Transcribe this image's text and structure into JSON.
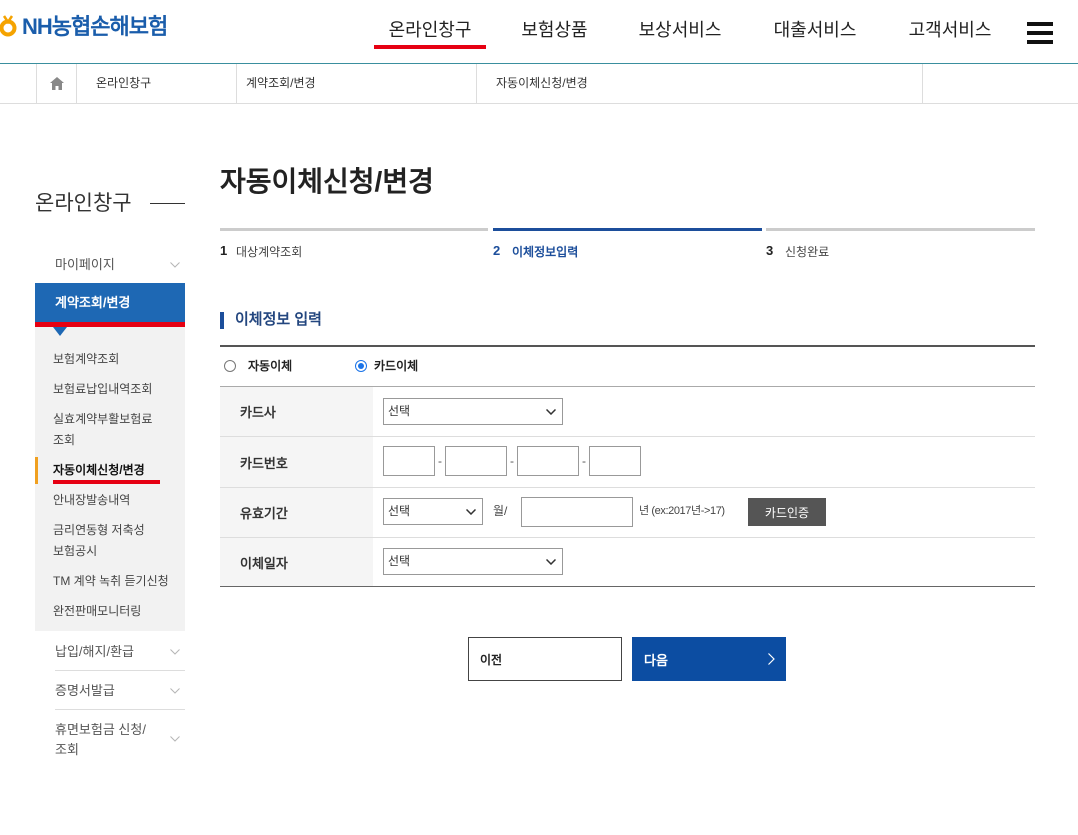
{
  "colors": {
    "brand_blue": "#1a5dab",
    "nav_underline_red": "#e60012",
    "header_line": "#3a8f9e",
    "menu_active_blue": "#1e68b4",
    "step_active_blue": "#1c4e9b",
    "next_button_blue": "#0c4da2",
    "logo_yellow": "#f5a300",
    "current_item_orange": "#f0a020",
    "radio_checked_blue": "#1a73e8",
    "section_title_navy": "#23467f"
  },
  "header": {
    "logo_icon": "nh-logo-icon",
    "logo_text": "NH농협손해보험",
    "nav": [
      {
        "label": "온라인창구",
        "active": true
      },
      {
        "label": "보험상품",
        "active": false
      },
      {
        "label": "보상서비스",
        "active": false
      },
      {
        "label": "대출서비스",
        "active": false
      },
      {
        "label": "고객서비스",
        "active": false
      }
    ],
    "menu_icon": "hamburger-menu-icon"
  },
  "breadcrumb": {
    "home_icon": "home-icon",
    "items": [
      "온라인창구",
      "계약조회/변경",
      "자동이체신청/변경"
    ]
  },
  "sidebar": {
    "title": "온라인창구",
    "menus": [
      {
        "label": "마이페이지",
        "expanded": false
      },
      {
        "label": "계약조회/변경",
        "expanded": true,
        "active": true,
        "children": [
          {
            "label": "보험계약조회",
            "current": false
          },
          {
            "label": "보험료납입내역조회",
            "current": false
          },
          {
            "label": "실효계약부활보험료\n조회",
            "current": false
          },
          {
            "label": "자동이체신청/변경",
            "current": true
          },
          {
            "label": "안내장발송내역",
            "current": false
          },
          {
            "label": "금리연동형 저축성\n보험공시",
            "current": false
          },
          {
            "label": "TM 계약 녹취 듣기신청",
            "current": false
          },
          {
            "label": "완전판매모니터링",
            "current": false
          }
        ]
      },
      {
        "label": "납입/해지/환급",
        "expanded": false
      },
      {
        "label": "증명서발급",
        "expanded": false
      },
      {
        "label": "휴면보험금 신청/\n조회",
        "expanded": false
      }
    ]
  },
  "page": {
    "title": "자동이체신청/변경"
  },
  "steps": [
    {
      "number": "1",
      "label": "대상계약조회",
      "active": false
    },
    {
      "number": "2",
      "label": "이체정보입력",
      "active": true
    },
    {
      "number": "3",
      "label": "신청완료",
      "active": false
    }
  ],
  "section": {
    "title": "이체정보 입력"
  },
  "form": {
    "payment_type": [
      {
        "label": "자동이체",
        "checked": false
      },
      {
        "label": "카드이체",
        "checked": true
      }
    ],
    "card_company": {
      "label": "카드사",
      "selected": "선택"
    },
    "card_number": {
      "label": "카드번호",
      "separator": "-"
    },
    "expiry": {
      "label": "유효기간",
      "month_selected": "선택",
      "month_suffix": "월/",
      "year_hint": "년 (ex:2017년->17)",
      "verify_button": "카드인증"
    },
    "transfer_day": {
      "label": "이체일자",
      "selected": "선택"
    }
  },
  "buttons": {
    "prev": "이전",
    "next": "다음"
  }
}
